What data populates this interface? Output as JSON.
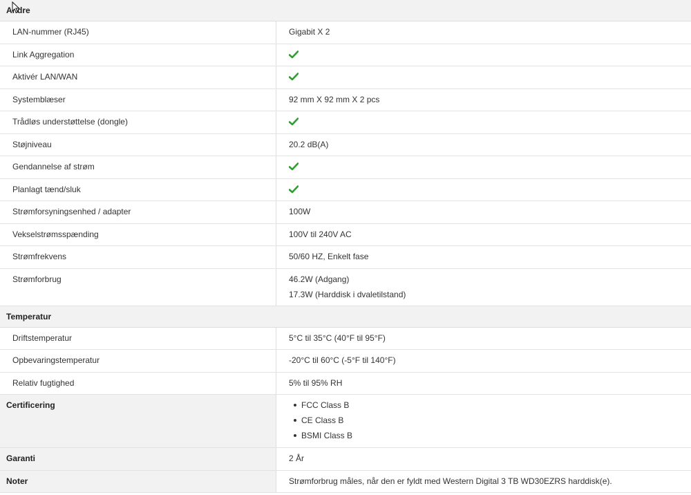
{
  "colors": {
    "check": "#2e9e2e",
    "section_bg": "#f2f2f2",
    "border": "#dddddd"
  },
  "sections": {
    "andre": "Andre",
    "temperatur": "Temperatur"
  },
  "andre_rows": {
    "lan": {
      "label": "LAN-nummer (RJ45)",
      "value": "Gigabit X 2"
    },
    "link": {
      "label": "Link Aggregation",
      "value": "check-icon"
    },
    "lanwan": {
      "label": "Aktivér LAN/WAN",
      "value": "check-icon"
    },
    "fan": {
      "label": "Systemblæser",
      "value": "92 mm X 92 mm X 2 pcs"
    },
    "wireless": {
      "label": "Trådløs understøttelse (dongle)",
      "value": "check-icon"
    },
    "noise": {
      "label": "Støjniveau",
      "value": "20.2 dB(A)"
    },
    "recovery": {
      "label": "Gendannelse af strøm",
      "value": "check-icon"
    },
    "schedule": {
      "label": "Planlagt tænd/sluk",
      "value": "check-icon"
    },
    "psu": {
      "label": "Strømforsyningsenhed / adapter",
      "value": "100W"
    },
    "voltage": {
      "label": "Vekselstrømsspænding",
      "value": "100V til 240V AC"
    },
    "frequency": {
      "label": "Strømfrekvens",
      "value": "50/60 HZ, Enkelt fase"
    },
    "consumption": {
      "label": "Strømforbrug",
      "line1": "46.2W (Adgang)",
      "line2": "17.3W (Harddisk i dvaletilstand)"
    }
  },
  "temperatur_rows": {
    "operating": {
      "label": "Driftstemperatur",
      "value": "5°C til 35°C (40°F til 95°F)"
    },
    "storage": {
      "label": "Opbevaringstemperatur",
      "value": "-20°C til 60°C (-5°F til 140°F)"
    },
    "humidity": {
      "label": "Relativ fugtighed",
      "value": "5% til 95% RH"
    }
  },
  "certificering": {
    "label": "Certificering",
    "items": [
      "FCC Class B",
      "CE Class B",
      "BSMI Class B"
    ]
  },
  "garanti": {
    "label": "Garanti",
    "value": "2 År"
  },
  "noter": {
    "label": "Noter",
    "value": "Strømforbrug måles, når den er fyldt med Western Digital 3 TB WD30EZRS harddisk(e)."
  }
}
